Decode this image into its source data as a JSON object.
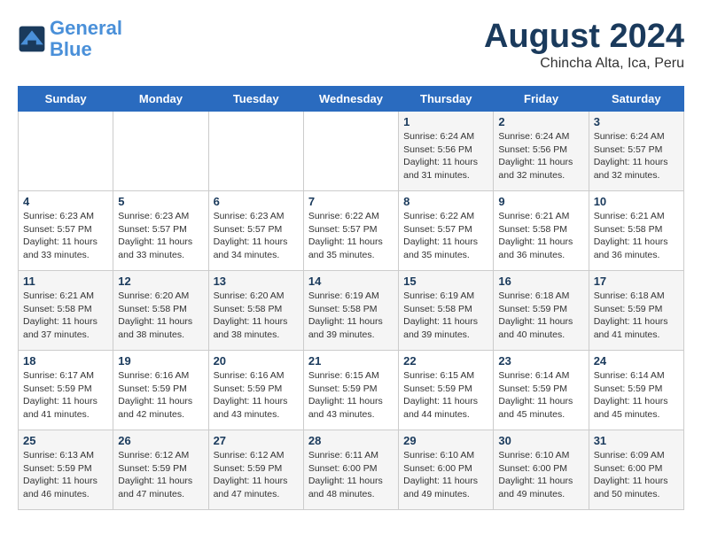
{
  "header": {
    "logo_line1": "General",
    "logo_line2": "Blue",
    "month_year": "August 2024",
    "location": "Chincha Alta, Ica, Peru"
  },
  "weekdays": [
    "Sunday",
    "Monday",
    "Tuesday",
    "Wednesday",
    "Thursday",
    "Friday",
    "Saturday"
  ],
  "weeks": [
    [
      {
        "day": "",
        "info": ""
      },
      {
        "day": "",
        "info": ""
      },
      {
        "day": "",
        "info": ""
      },
      {
        "day": "",
        "info": ""
      },
      {
        "day": "1",
        "sunrise": "6:24 AM",
        "sunset": "5:56 PM",
        "daylight": "11 hours and 31 minutes."
      },
      {
        "day": "2",
        "sunrise": "6:24 AM",
        "sunset": "5:56 PM",
        "daylight": "11 hours and 32 minutes."
      },
      {
        "day": "3",
        "sunrise": "6:24 AM",
        "sunset": "5:57 PM",
        "daylight": "11 hours and 32 minutes."
      }
    ],
    [
      {
        "day": "4",
        "sunrise": "6:23 AM",
        "sunset": "5:57 PM",
        "daylight": "11 hours and 33 minutes."
      },
      {
        "day": "5",
        "sunrise": "6:23 AM",
        "sunset": "5:57 PM",
        "daylight": "11 hours and 33 minutes."
      },
      {
        "day": "6",
        "sunrise": "6:23 AM",
        "sunset": "5:57 PM",
        "daylight": "11 hours and 34 minutes."
      },
      {
        "day": "7",
        "sunrise": "6:22 AM",
        "sunset": "5:57 PM",
        "daylight": "11 hours and 35 minutes."
      },
      {
        "day": "8",
        "sunrise": "6:22 AM",
        "sunset": "5:57 PM",
        "daylight": "11 hours and 35 minutes."
      },
      {
        "day": "9",
        "sunrise": "6:21 AM",
        "sunset": "5:58 PM",
        "daylight": "11 hours and 36 minutes."
      },
      {
        "day": "10",
        "sunrise": "6:21 AM",
        "sunset": "5:58 PM",
        "daylight": "11 hours and 36 minutes."
      }
    ],
    [
      {
        "day": "11",
        "sunrise": "6:21 AM",
        "sunset": "5:58 PM",
        "daylight": "11 hours and 37 minutes."
      },
      {
        "day": "12",
        "sunrise": "6:20 AM",
        "sunset": "5:58 PM",
        "daylight": "11 hours and 38 minutes."
      },
      {
        "day": "13",
        "sunrise": "6:20 AM",
        "sunset": "5:58 PM",
        "daylight": "11 hours and 38 minutes."
      },
      {
        "day": "14",
        "sunrise": "6:19 AM",
        "sunset": "5:58 PM",
        "daylight": "11 hours and 39 minutes."
      },
      {
        "day": "15",
        "sunrise": "6:19 AM",
        "sunset": "5:58 PM",
        "daylight": "11 hours and 39 minutes."
      },
      {
        "day": "16",
        "sunrise": "6:18 AM",
        "sunset": "5:59 PM",
        "daylight": "11 hours and 40 minutes."
      },
      {
        "day": "17",
        "sunrise": "6:18 AM",
        "sunset": "5:59 PM",
        "daylight": "11 hours and 41 minutes."
      }
    ],
    [
      {
        "day": "18",
        "sunrise": "6:17 AM",
        "sunset": "5:59 PM",
        "daylight": "11 hours and 41 minutes."
      },
      {
        "day": "19",
        "sunrise": "6:16 AM",
        "sunset": "5:59 PM",
        "daylight": "11 hours and 42 minutes."
      },
      {
        "day": "20",
        "sunrise": "6:16 AM",
        "sunset": "5:59 PM",
        "daylight": "11 hours and 43 minutes."
      },
      {
        "day": "21",
        "sunrise": "6:15 AM",
        "sunset": "5:59 PM",
        "daylight": "11 hours and 43 minutes."
      },
      {
        "day": "22",
        "sunrise": "6:15 AM",
        "sunset": "5:59 PM",
        "daylight": "11 hours and 44 minutes."
      },
      {
        "day": "23",
        "sunrise": "6:14 AM",
        "sunset": "5:59 PM",
        "daylight": "11 hours and 45 minutes."
      },
      {
        "day": "24",
        "sunrise": "6:14 AM",
        "sunset": "5:59 PM",
        "daylight": "11 hours and 45 minutes."
      }
    ],
    [
      {
        "day": "25",
        "sunrise": "6:13 AM",
        "sunset": "5:59 PM",
        "daylight": "11 hours and 46 minutes."
      },
      {
        "day": "26",
        "sunrise": "6:12 AM",
        "sunset": "5:59 PM",
        "daylight": "11 hours and 47 minutes."
      },
      {
        "day": "27",
        "sunrise": "6:12 AM",
        "sunset": "5:59 PM",
        "daylight": "11 hours and 47 minutes."
      },
      {
        "day": "28",
        "sunrise": "6:11 AM",
        "sunset": "6:00 PM",
        "daylight": "11 hours and 48 minutes."
      },
      {
        "day": "29",
        "sunrise": "6:10 AM",
        "sunset": "6:00 PM",
        "daylight": "11 hours and 49 minutes."
      },
      {
        "day": "30",
        "sunrise": "6:10 AM",
        "sunset": "6:00 PM",
        "daylight": "11 hours and 49 minutes."
      },
      {
        "day": "31",
        "sunrise": "6:09 AM",
        "sunset": "6:00 PM",
        "daylight": "11 hours and 50 minutes."
      }
    ]
  ]
}
